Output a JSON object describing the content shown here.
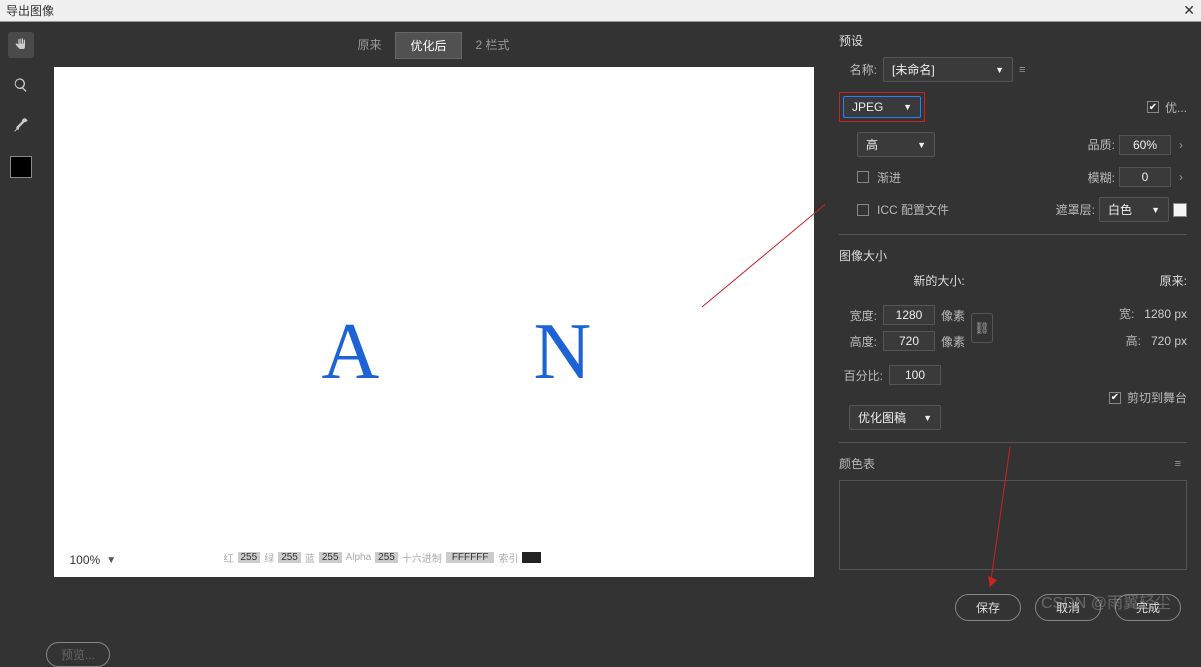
{
  "title": "导出图像",
  "tabs": {
    "original": "原来",
    "optimized": "优化后",
    "two_up": "2 栏式"
  },
  "canvas": {
    "letterA": "A",
    "letterN": "N"
  },
  "zoom": {
    "value": "100%"
  },
  "info": {
    "r_lbl": "红",
    "r": "255",
    "g_lbl": "绿",
    "g": "255",
    "b_lbl": "蓝",
    "b": "255",
    "a_lbl": "Alpha",
    "a": "255",
    "hex_lbl": "十六进制",
    "hex": "FFFFFF",
    "idx_lbl": "索引",
    "idx_val": "--"
  },
  "preview_btn": "预览...",
  "preset": {
    "title": "预设",
    "name_lbl": "名称:",
    "name_value": "[未命名]",
    "format": "JPEG",
    "optimize_lbl": "优...",
    "quality_sel": "高",
    "quality_lbl": "品质:",
    "quality_val": "60%",
    "progressive": "渐进",
    "blur_lbl": "模糊:",
    "blur_val": "0",
    "icc": "ICC 配置文件",
    "matte_lbl": "遮罩层:",
    "matte_val": "白色"
  },
  "imagesize": {
    "title": "图像大小",
    "new_title": "新的大小:",
    "orig_title": "原来:",
    "w_lbl": "宽度:",
    "w_val": "1280",
    "w_unit": "像素",
    "h_lbl": "高度:",
    "h_val": "720",
    "h_unit": "像素",
    "pct_lbl": "百分比:",
    "pct_val": "100",
    "optimize_art": "优化图稿",
    "orig_w_lbl": "宽:",
    "orig_w": "1280 px",
    "orig_h_lbl": "高:",
    "orig_h": "720 px",
    "clip_lbl": "剪切到舞台"
  },
  "colortable": {
    "title": "颜色表"
  },
  "buttons": {
    "save": "保存",
    "cancel": "取消",
    "done": "完成"
  },
  "watermark": "CSDN @雨翼轻尘"
}
